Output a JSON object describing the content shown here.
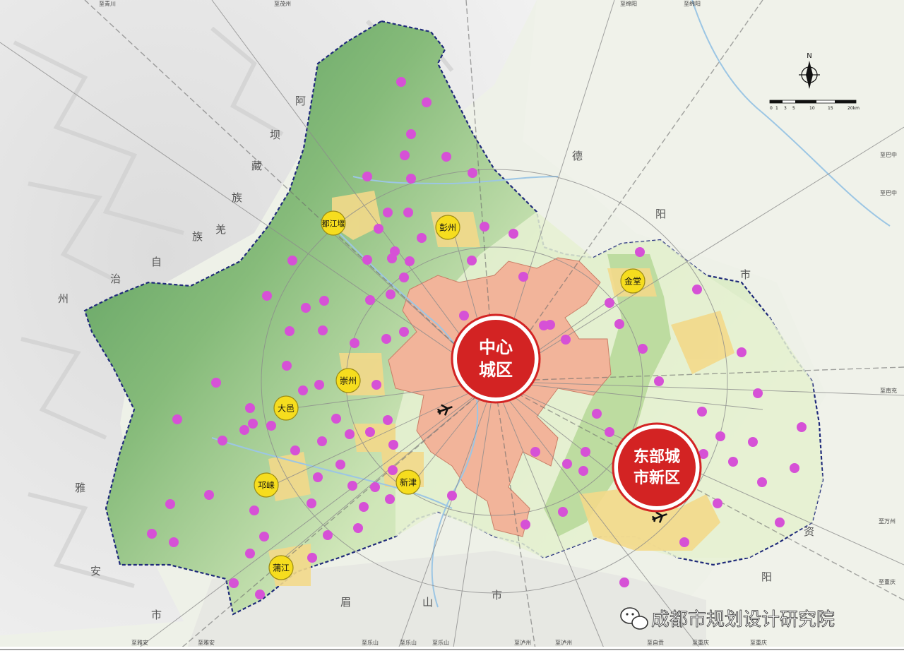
{
  "map": {
    "colors": {
      "background_mountain": "#e9eaea",
      "plain": "#eef1e6",
      "region_fill": "#cde5b6",
      "region_dark": "#6fa868",
      "boundary": "#1f2a7a",
      "urban_core": "#f2b49a",
      "urban_yellow": "#f3d98a",
      "poi": "#d651d6",
      "district_marker": "#f6dd1e",
      "core_circle": "#d32323"
    },
    "core_zones": {
      "central": {
        "line1": "中心",
        "line2": "城区"
      },
      "eastern": {
        "line1": "东部城",
        "line2": "市新区"
      }
    },
    "district_labels": [
      "都江堰",
      "彭州",
      "金堂",
      "崇州",
      "大邑",
      "邛崃",
      "新津",
      "蒲江"
    ],
    "region_labels": {
      "aba": [
        "阿",
        "坝",
        "藏",
        "族",
        "羌",
        "族",
        "自",
        "治",
        "州"
      ],
      "deyang": [
        "德",
        "阳",
        "市"
      ],
      "ziyang": [
        "资",
        "阳"
      ],
      "yaan": [
        "雅",
        "安",
        "市"
      ],
      "meishan": [
        "眉",
        "山",
        "市"
      ]
    },
    "edge_labels": {
      "top": [
        "至青川",
        "至茂州",
        "至绵阳",
        "至绵阳"
      ],
      "right": [
        "至巴中",
        "至巴中",
        "至南充",
        "至万州",
        "至重庆"
      ],
      "bottom": [
        "至雅安",
        "至雅安",
        "至乐山",
        "至乐山",
        "至乐山",
        "至泸州",
        "至泸州",
        "至自贡",
        "至重庆",
        "至重庆"
      ]
    },
    "compass_label": "N",
    "scale_labels": [
      "0",
      "1",
      "3",
      "5",
      "10",
      "15",
      "20km"
    ],
    "watermark": "成都市规划设计研究院"
  }
}
